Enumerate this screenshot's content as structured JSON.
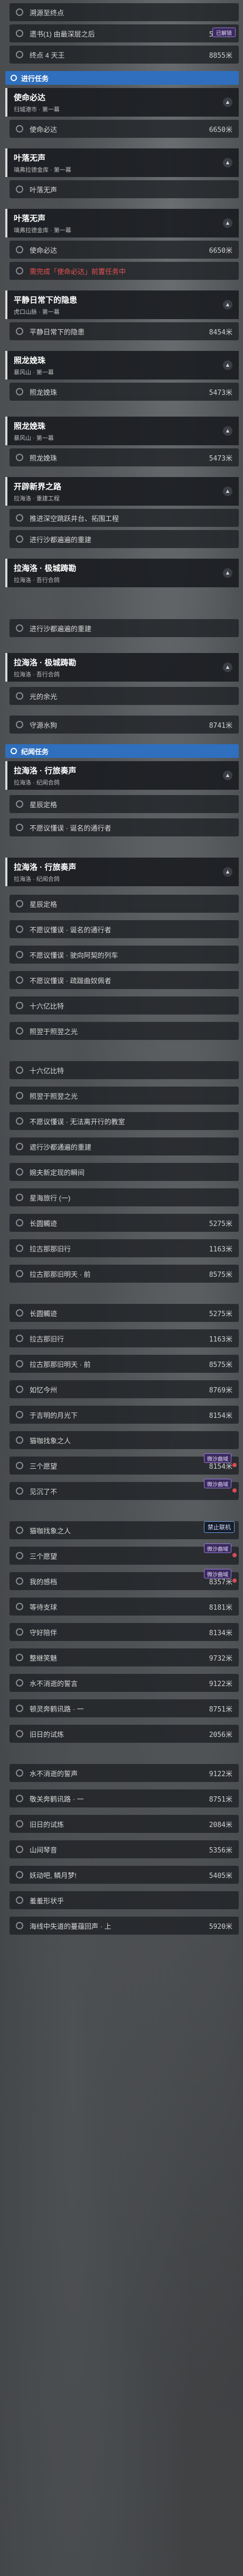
{
  "top_badge": "已解锁",
  "side_badge": "禁止联机",
  "block1": [
    {
      "label": "溯源至终点",
      "dist": ""
    },
    {
      "label": "遗书(1) 由最深层之后",
      "dist": "5214米"
    },
    {
      "label": "终点 4 天王",
      "dist": "8855米"
    }
  ],
  "section_main": "进行任务",
  "q1": {
    "title": "使命必达",
    "sub": "归城港市 · 第一幕"
  },
  "q1_rows": [
    {
      "label": "使命必达",
      "dist": "6650米"
    }
  ],
  "q2": {
    "title": "叶落无声",
    "sub": "璃弗拉德金库 · 第一幕"
  },
  "q2_rows": [
    {
      "label": "叶落无声",
      "dist": ""
    }
  ],
  "q3": {
    "title": "叶落无声",
    "sub": "璃弗拉德金库 · 第一幕"
  },
  "q3_rows": [
    {
      "label": "使命必达",
      "dist": "6650米"
    }
  ],
  "q3_warn": "需完成「使命必达」前置任务中",
  "q4": {
    "title": "平静日常下的隐患",
    "sub": "虎口山脉 · 第一幕"
  },
  "q4_rows": [
    {
      "label": "平静日常下的隐患",
      "dist": "8454米"
    }
  ],
  "q5": {
    "title": "照龙娩珠",
    "sub": "暴风山 · 第一幕"
  },
  "q5_rows": [
    {
      "label": "照龙娩珠",
      "dist": "5473米"
    }
  ],
  "q6": {
    "title": "照龙娩珠",
    "sub": "暴风山 · 第一幕"
  },
  "q6_rows": [
    {
      "label": "照龙娩珠",
      "dist": "5473米"
    }
  ],
  "q7": {
    "title": "开辟新界之路",
    "sub": "拉海洛 · 重建工程"
  },
  "q7_rows": [
    {
      "label": "推进深空跳跃井台、拓围工程",
      "dist": ""
    },
    {
      "label": "进行沙都遍遍的重建",
      "dist": ""
    }
  ],
  "q8": {
    "title": "拉海洛 · 极城踌勘",
    "sub": "拉海洛 · 吾行合鸽"
  },
  "q8_rows": [
    {
      "label": "进行沙都遍遍的重建",
      "dist": ""
    }
  ],
  "q9": {
    "title": "拉海洛 · 极城踌勘",
    "sub": "拉海洛 · 吾行合鸽"
  },
  "q9_rows": [
    {
      "label": "光的余光",
      "dist": ""
    },
    {
      "label": "守源水狗",
      "dist": "8741米"
    }
  ],
  "section_side": "纪闻任务",
  "q10": {
    "title": "拉海洛 · 行旅奏声",
    "sub": "拉海洛 · 纪闻合鸽"
  },
  "q10_rows": [
    {
      "label": "星辰定格",
      "dist": ""
    },
    {
      "label": "不愿议懂误 · 诞名的通行者",
      "dist": ""
    }
  ],
  "q11": {
    "title": "拉海洛 · 行旅奏声",
    "sub": "拉海洛 · 纪闻合鸽"
  },
  "q11_rows": [
    {
      "label": "星辰定格",
      "dist": ""
    },
    {
      "label": "不愿议懂误 · 诞名的通行者",
      "dist": ""
    },
    {
      "label": "不愿议懂误 · 驶向阿契的列车",
      "dist": ""
    },
    {
      "label": "不愿议懂误 · 疏跋曲奴佩者",
      "dist": ""
    },
    {
      "label": "十六亿比特",
      "dist": ""
    },
    {
      "label": "照翌于照翌之光",
      "dist": ""
    }
  ],
  "list_a": [
    {
      "label": "十六亿比特",
      "dist": ""
    },
    {
      "label": "照翌于照翌之光",
      "dist": ""
    },
    {
      "label": "不愿议懂误 · 无法离开行的教室",
      "dist": ""
    },
    {
      "label": "遮行沙都通遍的重建",
      "dist": ""
    },
    {
      "label": "婉夫新定现的瞬间",
      "dist": ""
    },
    {
      "label": "星海旅行 (一)",
      "dist": ""
    },
    {
      "label": "长圆觸迹",
      "dist": "5275米"
    },
    {
      "label": "拉古那那旧行",
      "dist": "1163米"
    },
    {
      "label": "拉古那那旧明天 · 前",
      "dist": "8575米"
    }
  ],
  "list_b": [
    {
      "label": "长圆觸迹",
      "dist": "5275米"
    },
    {
      "label": "拉古那旧行",
      "dist": "1163米"
    },
    {
      "label": "拉古那那旧明天 · 前",
      "dist": "8575米"
    },
    {
      "label": "如忆今州",
      "dist": "8769米"
    },
    {
      "label": "于吉明的月光下",
      "dist": "8154米"
    },
    {
      "label": "猫咖找象之人",
      "dist": ""
    },
    {
      "label": "三个愿望",
      "dist": "8154米",
      "tag": "微沙曲域"
    },
    {
      "label": "见沉了不",
      "dist": "",
      "tag": "微沙曲域"
    }
  ],
  "list_c": [
    {
      "label": "猫咖找象之人",
      "dist": ""
    },
    {
      "label": "三个愿望",
      "dist": "",
      "tag": "微沙曲域"
    },
    {
      "label": "我的感档",
      "dist": "8357米",
      "tag": "微沙曲域"
    },
    {
      "label": "等待支球",
      "dist": "8181米"
    },
    {
      "label": "守好陪伴",
      "dist": "8134米"
    },
    {
      "label": "整继笑魅",
      "dist": "9732米"
    },
    {
      "label": "水不消逝的誓言",
      "dist": "9122米"
    },
    {
      "label": "顿灵奔鹤讯路 · 一",
      "dist": "8751米"
    },
    {
      "label": "旧日的试炼",
      "dist": "2056米"
    }
  ],
  "list_d": [
    {
      "label": "水不消逝的誓声",
      "dist": "9122米"
    },
    {
      "label": "敬关奔鹤讯路 · 一",
      "dist": "8751米"
    },
    {
      "label": "旧日的试炼",
      "dist": "2084米"
    },
    {
      "label": "山间琴音",
      "dist": "5356米"
    },
    {
      "label": "妖动吧, 鳞月梦!",
      "dist": "5405米"
    },
    {
      "label": "羞羞形状乎",
      "dist": ""
    },
    {
      "label": "海线中失道的蔓蕴回声 · 上",
      "dist": "5920米"
    }
  ]
}
